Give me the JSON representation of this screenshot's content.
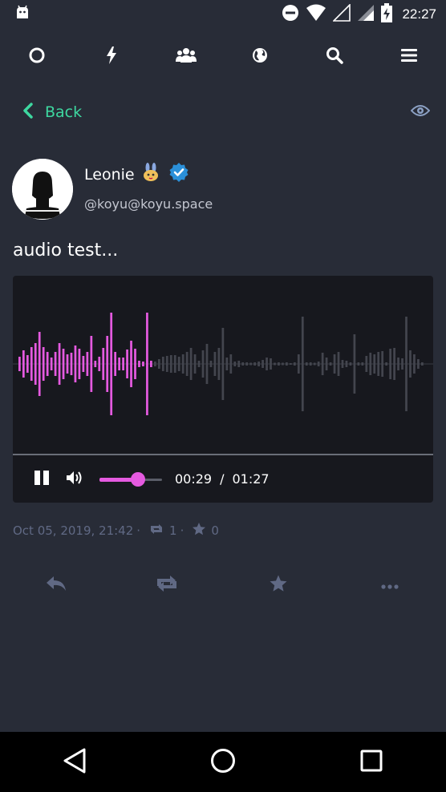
{
  "status_bar": {
    "time": "22:27",
    "icons": [
      "android-icon",
      "do-not-disturb-icon",
      "wifi-icon",
      "signal-empty-icon",
      "signal-icon",
      "battery-charging-icon"
    ]
  },
  "top_nav": {
    "items": [
      "home-circle-icon",
      "notifications-bolt-icon",
      "local-timeline-users-icon",
      "federated-globe-icon",
      "search-icon",
      "menu-icon"
    ]
  },
  "back": {
    "label": "Back"
  },
  "author": {
    "display_name": "Leonie",
    "acct": "@koyu@koyu.space"
  },
  "status": {
    "content": "audio test..."
  },
  "audio": {
    "current_time": "00:29",
    "separator": "/",
    "duration": "01:27",
    "progress": 0.333,
    "volume": 0.62,
    "played_color": "#e55ae0",
    "unplayed_color": "#43454e"
  },
  "meta": {
    "date": "Oct 05, 2019, 21:42",
    "separator": "·",
    "reblogs": "1",
    "favourites": "0"
  },
  "colors": {
    "background": "#282c37",
    "accent_green": "#3ed8a0",
    "muted": "#606984",
    "verified_blue": "#2b90d9"
  }
}
